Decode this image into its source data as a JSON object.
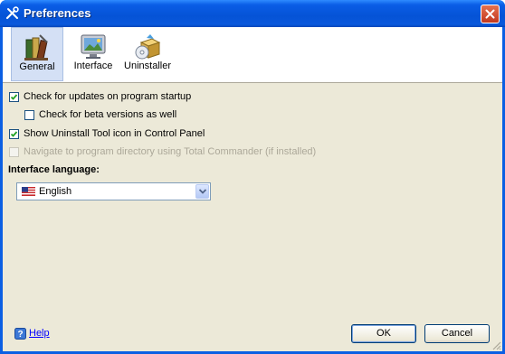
{
  "window": {
    "title": "Preferences",
    "title_icon": "wrench-tools-icon",
    "close_icon": "close-icon"
  },
  "toolbar": {
    "items": [
      {
        "label": "General",
        "icon": "books-icon",
        "selected": true
      },
      {
        "label": "Interface",
        "icon": "monitor-landscape-icon",
        "selected": false
      },
      {
        "label": "Uninstaller",
        "icon": "box-cd-icon",
        "selected": false
      }
    ]
  },
  "options": {
    "check_updates": {
      "label": "Check for updates on program startup",
      "checked": true,
      "enabled": true
    },
    "check_beta": {
      "label": "Check for beta versions as well",
      "checked": false,
      "enabled": true
    },
    "show_control_panel": {
      "label": "Show Uninstall Tool icon in Control Panel",
      "checked": true,
      "enabled": true
    },
    "navigate_total_commander": {
      "label": "Navigate to program directory using Total Commander (if installed)",
      "checked": false,
      "enabled": false
    }
  },
  "language": {
    "label": "Interface language:",
    "selected": "English",
    "flag_icon": "us-flag-icon"
  },
  "footer": {
    "help_label": "Help",
    "ok_label": "OK",
    "cancel_label": "Cancel"
  },
  "colors": {
    "titlebar": "#0553d6",
    "dialog_bg": "#ece9d8",
    "selected_tab": "#d4e0f5",
    "link": "#0000ff"
  }
}
